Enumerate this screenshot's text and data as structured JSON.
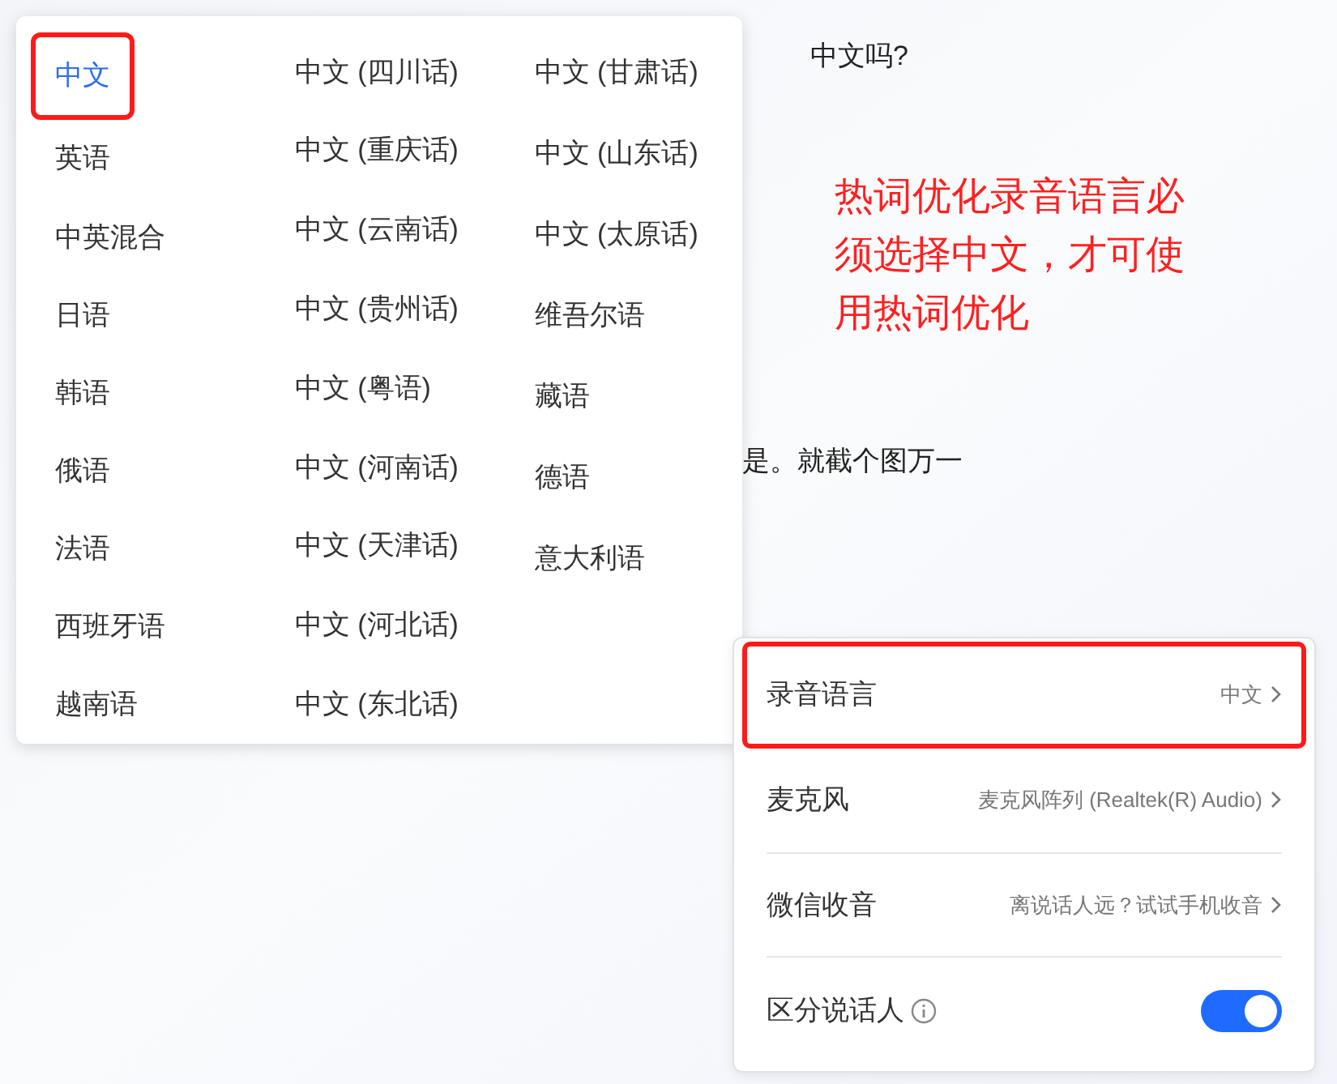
{
  "background_text": [
    "中文吗?",
    "是。就截个图万一"
  ],
  "language_menu": {
    "columns": [
      [
        {
          "label": "中文",
          "selected": true,
          "highlighted": true
        },
        {
          "label": "英语",
          "selected": false,
          "highlighted": false
        },
        {
          "label": "中英混合",
          "selected": false,
          "highlighted": false
        },
        {
          "label": "日语",
          "selected": false,
          "highlighted": false
        },
        {
          "label": "韩语",
          "selected": false,
          "highlighted": false
        },
        {
          "label": "俄语",
          "selected": false,
          "highlighted": false
        },
        {
          "label": "法语",
          "selected": false,
          "highlighted": false
        },
        {
          "label": "西班牙语",
          "selected": false,
          "highlighted": false
        },
        {
          "label": "越南语",
          "selected": false,
          "highlighted": false
        }
      ],
      [
        {
          "label": "中文 (四川话)",
          "selected": false,
          "highlighted": false
        },
        {
          "label": "中文 (重庆话)",
          "selected": false,
          "highlighted": false
        },
        {
          "label": "中文 (云南话)",
          "selected": false,
          "highlighted": false
        },
        {
          "label": "中文 (贵州话)",
          "selected": false,
          "highlighted": false
        },
        {
          "label": "中文 (粤语)",
          "selected": false,
          "highlighted": false
        },
        {
          "label": "中文 (河南话)",
          "selected": false,
          "highlighted": false
        },
        {
          "label": "中文 (天津话)",
          "selected": false,
          "highlighted": false
        },
        {
          "label": "中文 (河北话)",
          "selected": false,
          "highlighted": false
        },
        {
          "label": "中文 (东北话)",
          "selected": false,
          "highlighted": false
        }
      ],
      [
        {
          "label": "中文 (甘肃话)",
          "selected": false,
          "highlighted": false
        },
        {
          "label": "中文 (山东话)",
          "selected": false,
          "highlighted": false
        },
        {
          "label": "中文 (太原话)",
          "selected": false,
          "highlighted": false
        },
        {
          "label": "维吾尔语",
          "selected": false,
          "highlighted": false
        },
        {
          "label": "藏语",
          "selected": false,
          "highlighted": false
        },
        {
          "label": "德语",
          "selected": false,
          "highlighted": false
        },
        {
          "label": "意大利语",
          "selected": false,
          "highlighted": false
        }
      ]
    ]
  },
  "annotation": "热词优化录音语言必须选择中文，才可使用热词优化",
  "settings": [
    {
      "kind": "link",
      "label": "录音语言",
      "value": "中文",
      "highlighted": true
    },
    {
      "kind": "link",
      "label": "麦克风",
      "value": "麦克风阵列 (Realtek(R) Audio)",
      "highlighted": false
    },
    {
      "kind": "link",
      "label": "微信收音",
      "value": "离说话人远？试试手机收音",
      "highlighted": false
    },
    {
      "kind": "toggle",
      "label": "区分说话人",
      "on": true
    }
  ]
}
